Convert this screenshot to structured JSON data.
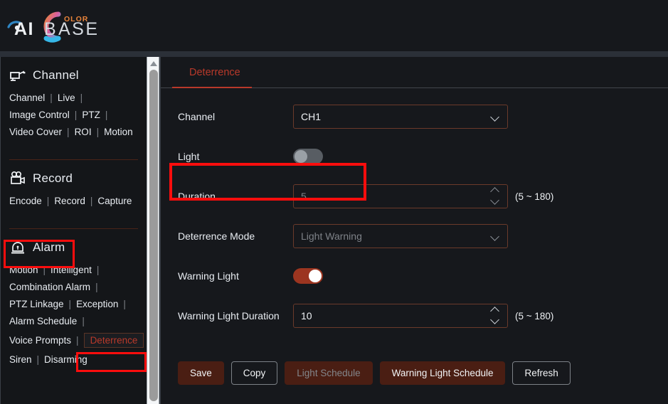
{
  "brand": {
    "name": "AIBASE",
    "sub": "OLOR",
    "accent": "#e8833a",
    "accent2": "#3aa6e8"
  },
  "sidebar": {
    "scroll_arrow_icon": "triangle-up-icon",
    "groups": [
      {
        "title": "Channel",
        "icon": "camera-icon",
        "rows": [
          [
            {
              "label": "Channel"
            },
            {
              "label": "Live"
            }
          ],
          [
            {
              "label": "Image Control"
            },
            {
              "label": "PTZ"
            }
          ],
          [
            {
              "label": "Video Cover"
            },
            {
              "label": "ROI"
            },
            {
              "label": "Motion",
              "trailing_sep": false
            }
          ]
        ]
      },
      {
        "title": "Record",
        "icon": "video-camera-icon",
        "rows": [
          [
            {
              "label": "Encode"
            },
            {
              "label": "Record"
            },
            {
              "label": "Capture",
              "trailing_sep": false
            }
          ]
        ]
      },
      {
        "title": "Alarm",
        "icon": "siren-icon",
        "highlighted": true,
        "rows": [
          [
            {
              "label": "Motion"
            },
            {
              "label": "Intelligent"
            }
          ],
          [
            {
              "label": "Combination Alarm"
            }
          ],
          [
            {
              "label": "PTZ Linkage"
            },
            {
              "label": "Exception"
            }
          ],
          [
            {
              "label": "Alarm Schedule"
            }
          ],
          [
            {
              "label": "Voice Prompts"
            },
            {
              "label": "Deterrence",
              "active": true
            }
          ],
          [
            {
              "label": "Siren"
            },
            {
              "label": "Disarming",
              "trailing_sep": false
            }
          ]
        ]
      }
    ],
    "separator_label": "|"
  },
  "main": {
    "tab": {
      "label": "Deterrence",
      "active": true
    },
    "fields": {
      "channel": {
        "label": "Channel",
        "value": "CH1",
        "icon": "chevron-down-icon",
        "enabled": true
      },
      "light": {
        "label": "Light",
        "toggle_on": false,
        "highlighted": true
      },
      "duration": {
        "label": "Duration",
        "value": "5",
        "hint": "(5 ~ 180)",
        "enabled": false,
        "icon": "spinner-icon"
      },
      "deterrence_mode": {
        "label": "Deterrence Mode",
        "value": "Light Warning",
        "icon": "chevron-down-icon",
        "enabled": false
      },
      "warning_light": {
        "label": "Warning Light",
        "toggle_on": true
      },
      "warning_light_duration": {
        "label": "Warning Light Duration",
        "value": "10",
        "hint": "(5 ~ 180)",
        "enabled": true,
        "icon": "spinner-icon"
      }
    },
    "buttons": [
      {
        "label": "Save",
        "style": "solid",
        "enabled": true
      },
      {
        "label": "Copy",
        "style": "outline",
        "enabled": true
      },
      {
        "label": "Light Schedule",
        "style": "solid",
        "enabled": false
      },
      {
        "label": "Warning Light Schedule",
        "style": "solid",
        "enabled": true
      },
      {
        "label": "Refresh",
        "style": "outline",
        "enabled": true
      }
    ]
  },
  "colors": {
    "accent_red": "#b9392a",
    "button_solid": "#4a1e13",
    "toggle_on": "#9c3520",
    "highlight_box": "#fd0d0d",
    "field_border": "#6b3a2a",
    "background": "#16181c"
  }
}
